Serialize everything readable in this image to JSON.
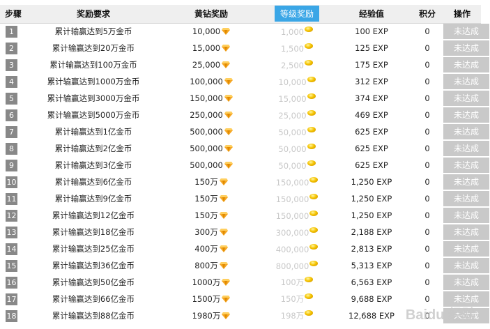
{
  "header": {
    "step": "步骤",
    "req": "奖励要求",
    "diamond": "黄钻奖励",
    "level": "等级奖励",
    "exp": "经验值",
    "points": "积分",
    "op": "操作"
  },
  "rows": [
    {
      "step": "1",
      "req": "累计输赢达到5万金币",
      "diamond": "10,000",
      "level": "1,000",
      "exp": "100 EXP",
      "points": "0",
      "op": "未达成"
    },
    {
      "step": "2",
      "req": "累计输赢达到20万金币",
      "diamond": "15,000",
      "level": "1,500",
      "exp": "125 EXP",
      "points": "0",
      "op": "未达成"
    },
    {
      "step": "3",
      "req": "累计输赢达到100万金币",
      "diamond": "25,000",
      "level": "2,500",
      "exp": "175 EXP",
      "points": "0",
      "op": "未达成"
    },
    {
      "step": "4",
      "req": "累计输赢达到1000万金币",
      "diamond": "100,000",
      "level": "10,000",
      "exp": "312 EXP",
      "points": "0",
      "op": "未达成"
    },
    {
      "step": "5",
      "req": "累计输赢达到3000万金币",
      "diamond": "150,000",
      "level": "15,000",
      "exp": "374 EXP",
      "points": "0",
      "op": "未达成"
    },
    {
      "step": "6",
      "req": "累计输赢达到5000万金币",
      "diamond": "250,000",
      "level": "25,000",
      "exp": "469 EXP",
      "points": "0",
      "op": "未达成"
    },
    {
      "step": "7",
      "req": "累计输赢达到1亿金币",
      "diamond": "500,000",
      "level": "50,000",
      "exp": "625 EXP",
      "points": "0",
      "op": "未达成"
    },
    {
      "step": "8",
      "req": "累计输赢达到2亿金币",
      "diamond": "500,000",
      "level": "50,000",
      "exp": "625 EXP",
      "points": "0",
      "op": "未达成"
    },
    {
      "step": "9",
      "req": "累计输赢达到3亿金币",
      "diamond": "500,000",
      "level": "50,000",
      "exp": "625 EXP",
      "points": "0",
      "op": "未达成"
    },
    {
      "step": "10",
      "req": "累计输赢达到6亿金币",
      "diamond": "150万",
      "level": "150,000",
      "exp": "1,250 EXP",
      "points": "0",
      "op": "未达成"
    },
    {
      "step": "11",
      "req": "累计输赢达到9亿金币",
      "diamond": "150万",
      "level": "150,000",
      "exp": "1,250 EXP",
      "points": "0",
      "op": "未达成"
    },
    {
      "step": "12",
      "req": "累计输赢达到12亿金币",
      "diamond": "150万",
      "level": "150,000",
      "exp": "1,250 EXP",
      "points": "0",
      "op": "未达成"
    },
    {
      "step": "13",
      "req": "累计输赢达到18亿金币",
      "diamond": "300万",
      "level": "300,000",
      "exp": "2,188 EXP",
      "points": "0",
      "op": "未达成"
    },
    {
      "step": "14",
      "req": "累计输赢达到25亿金币",
      "diamond": "400万",
      "level": "400,000",
      "exp": "2,813 EXP",
      "points": "0",
      "op": "未达成"
    },
    {
      "step": "15",
      "req": "累计输赢达到36亿金币",
      "diamond": "800万",
      "level": "800,000",
      "exp": "5,313 EXP",
      "points": "0",
      "op": "未达成"
    },
    {
      "step": "16",
      "req": "累计输赢达到50亿金币",
      "diamond": "1000万",
      "level": "100万",
      "exp": "6,563 EXP",
      "points": "0",
      "op": "未达成"
    },
    {
      "step": "17",
      "req": "累计输赢达到66亿金币",
      "diamond": "1500万",
      "level": "150万",
      "exp": "9,688 EXP",
      "points": "0",
      "op": "未达成"
    },
    {
      "step": "18",
      "req": "累计输赢达到88亿金币",
      "diamond": "1980万",
      "level": "198万",
      "exp": "12,688 EXP",
      "points": "0",
      "op": "未达成"
    }
  ],
  "icons": {
    "diamond": "diamond-icon",
    "coin": "gold-coin-icon"
  },
  "colors": {
    "highlight": "#3aa6e6",
    "step_badge": "#888888",
    "button_disabled": "#c9c9c9"
  }
}
